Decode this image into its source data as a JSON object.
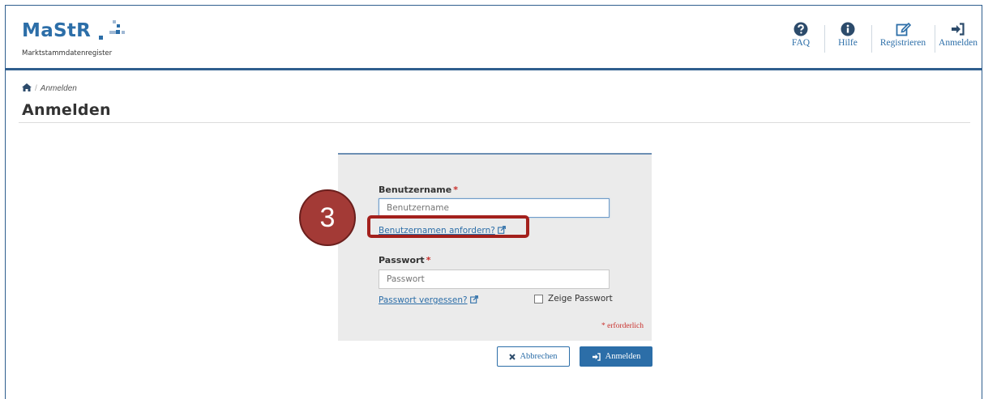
{
  "header": {
    "logo_word": "MaStR",
    "logo_sub": "Marktstammdatenregister",
    "nav": [
      {
        "label": "FAQ",
        "icon": "question-circle-icon"
      },
      {
        "label": "Hilfe",
        "icon": "info-circle-icon"
      },
      {
        "label": "Registrieren",
        "icon": "edit-icon"
      },
      {
        "label": "Anmelden",
        "icon": "sign-in-icon"
      }
    ]
  },
  "breadcrumb": {
    "home_icon": "home-icon",
    "current": "Anmelden"
  },
  "page": {
    "title": "Anmelden"
  },
  "form": {
    "username": {
      "label": "Benutzername",
      "required_mark": "*",
      "placeholder": "Benutzername",
      "value": ""
    },
    "request_username_link": "Benutzernamen anfordern?",
    "password": {
      "label": "Passwort",
      "required_mark": "*",
      "placeholder": "Passwort",
      "value": ""
    },
    "forgot_password_link": "Passwort vergessen?",
    "show_password_label": "Zeige Passwort",
    "show_password_checked": false,
    "required_note": "* erforderlich"
  },
  "buttons": {
    "cancel": "Abbrechen",
    "login": "Anmelden"
  },
  "annotation": {
    "step_number": "3"
  },
  "colors": {
    "brand_blue": "#2c6ea8",
    "header_border": "#2f5e8e",
    "required_red": "#c9302c",
    "annotation_red": "#a3201c"
  }
}
